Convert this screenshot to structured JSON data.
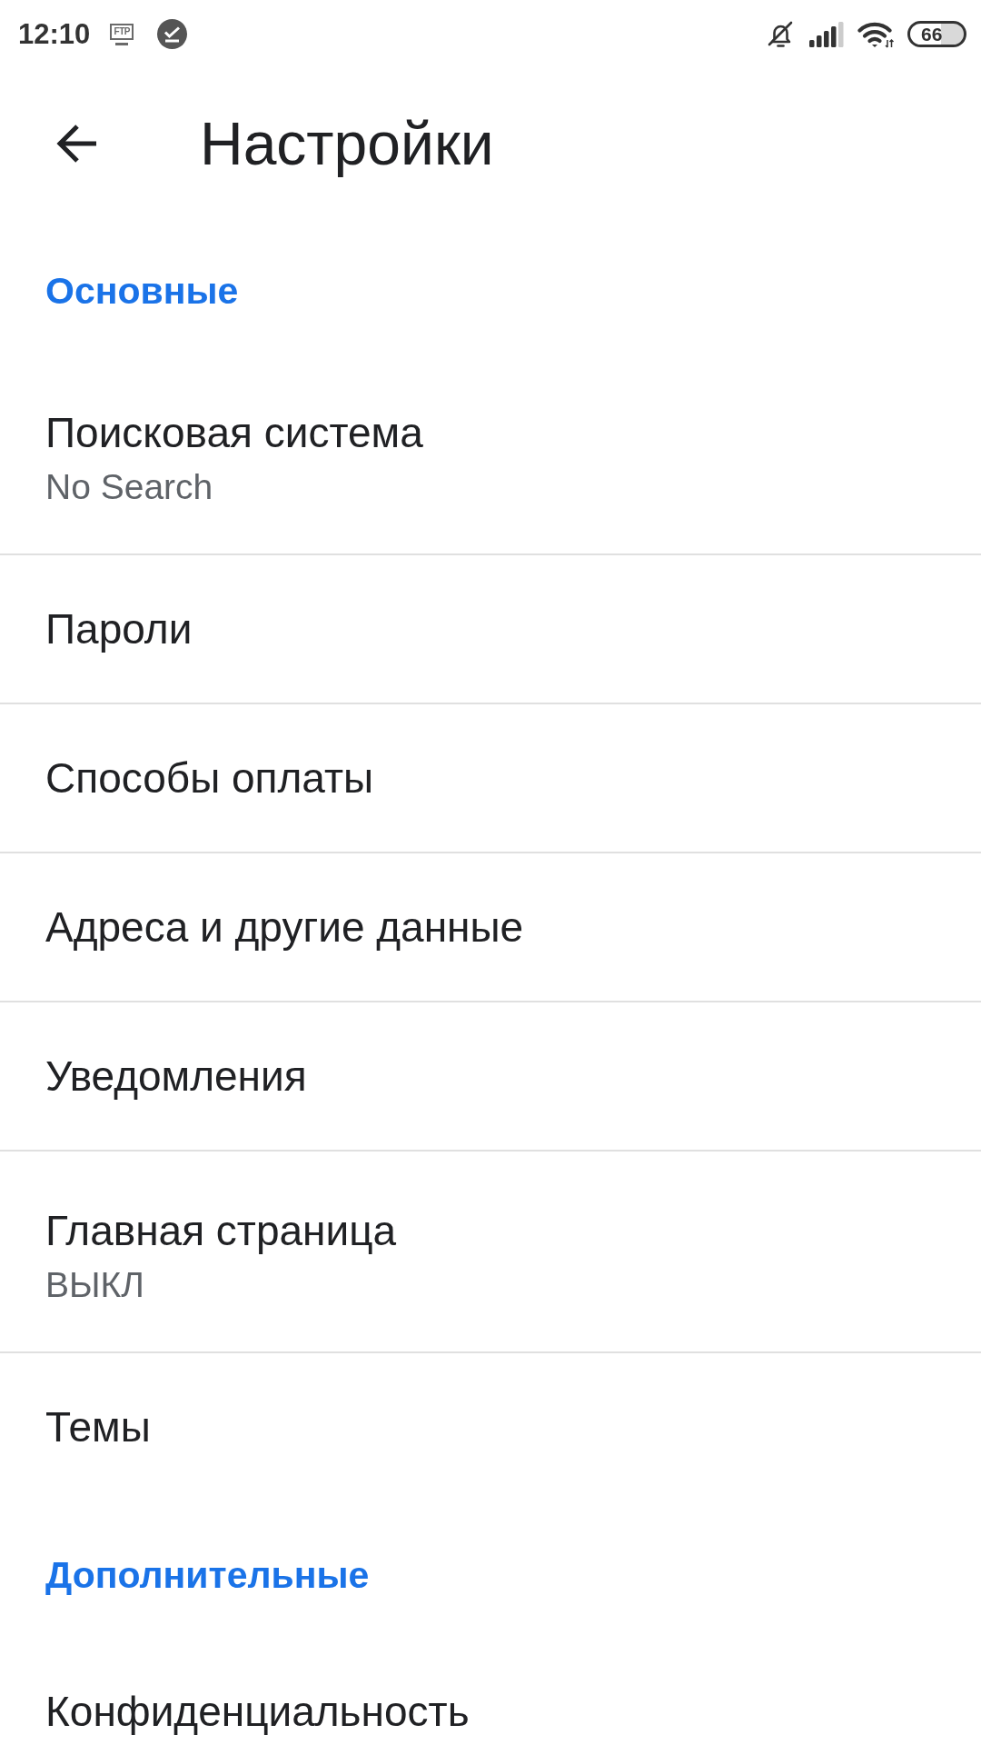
{
  "status_bar": {
    "time": "12:10",
    "ftp_label": "FTP",
    "battery": "66"
  },
  "toolbar": {
    "title": "Настройки"
  },
  "sections": [
    {
      "header": "Основные",
      "items": [
        {
          "title": "Поисковая система",
          "summary": "No Search"
        },
        {
          "title": "Пароли"
        },
        {
          "title": "Способы оплаты"
        },
        {
          "title": "Адреса и другие данные"
        },
        {
          "title": "Уведомления"
        },
        {
          "title": "Главная страница",
          "summary": "ВЫКЛ"
        },
        {
          "title": "Темы"
        }
      ]
    },
    {
      "header": "Дополнительные",
      "items": [
        {
          "title": "Конфиденциальность"
        }
      ]
    }
  ]
}
